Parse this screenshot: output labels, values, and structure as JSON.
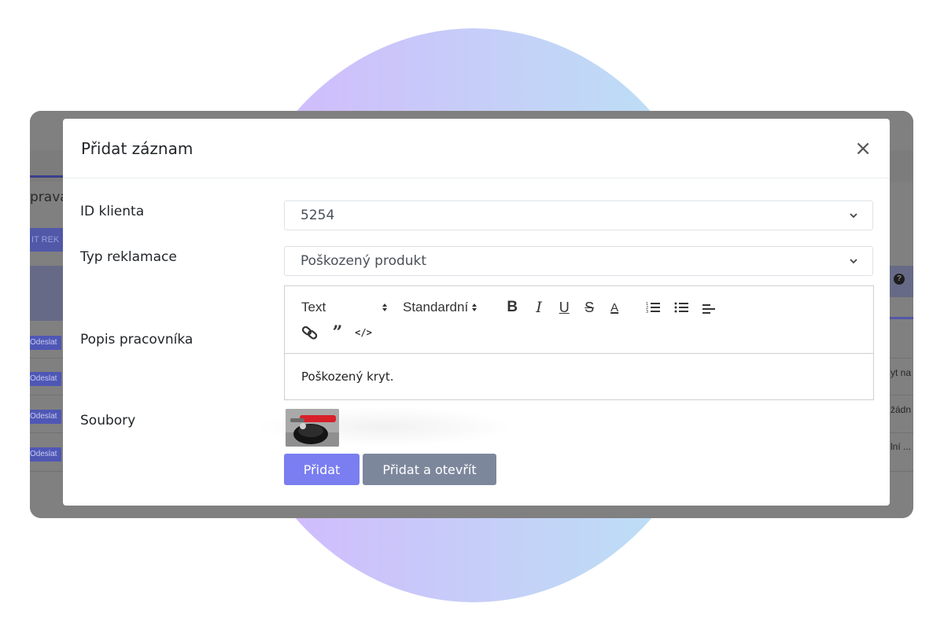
{
  "background": {
    "title_fragment": "prava",
    "new_button_fragment": "IT REK",
    "help_icon": "question-circle-icon",
    "send_buttons": [
      "Odeslat",
      "Odeslat",
      "Odeslat",
      "Odeslat"
    ],
    "right_column_texts": [
      "yt na",
      "žádn",
      "lní ..."
    ]
  },
  "modal": {
    "title": "Přidat záznam",
    "close_label": "×",
    "fields": {
      "client_id": {
        "label": "ID klienta",
        "value": "5254"
      },
      "complaint_type": {
        "label": "Typ reklamace",
        "value": "Poškozený produkt"
      },
      "worker_description": {
        "label": "Popis pracovníka",
        "content": "Poškozený kryt."
      },
      "files": {
        "label": "Soubory"
      }
    },
    "toolbar": {
      "font_select": "Text",
      "size_select": "Standardní",
      "buttons": [
        "bold-icon",
        "italic-icon",
        "underline-icon",
        "strikethrough-icon",
        "text-color-icon",
        "ordered-list-icon",
        "bullet-list-icon",
        "align-icon",
        "link-icon",
        "quote-icon",
        "code-icon"
      ]
    },
    "actions": {
      "add_label": "Přidat",
      "add_open_label": "Přidat a otevřít"
    }
  },
  "colors": {
    "primary": "#7a7ef0",
    "secondary": "#7d879c",
    "overlay": "#808080",
    "gradient_start": "#d4b6ff",
    "gradient_end": "#b9e4f4"
  }
}
